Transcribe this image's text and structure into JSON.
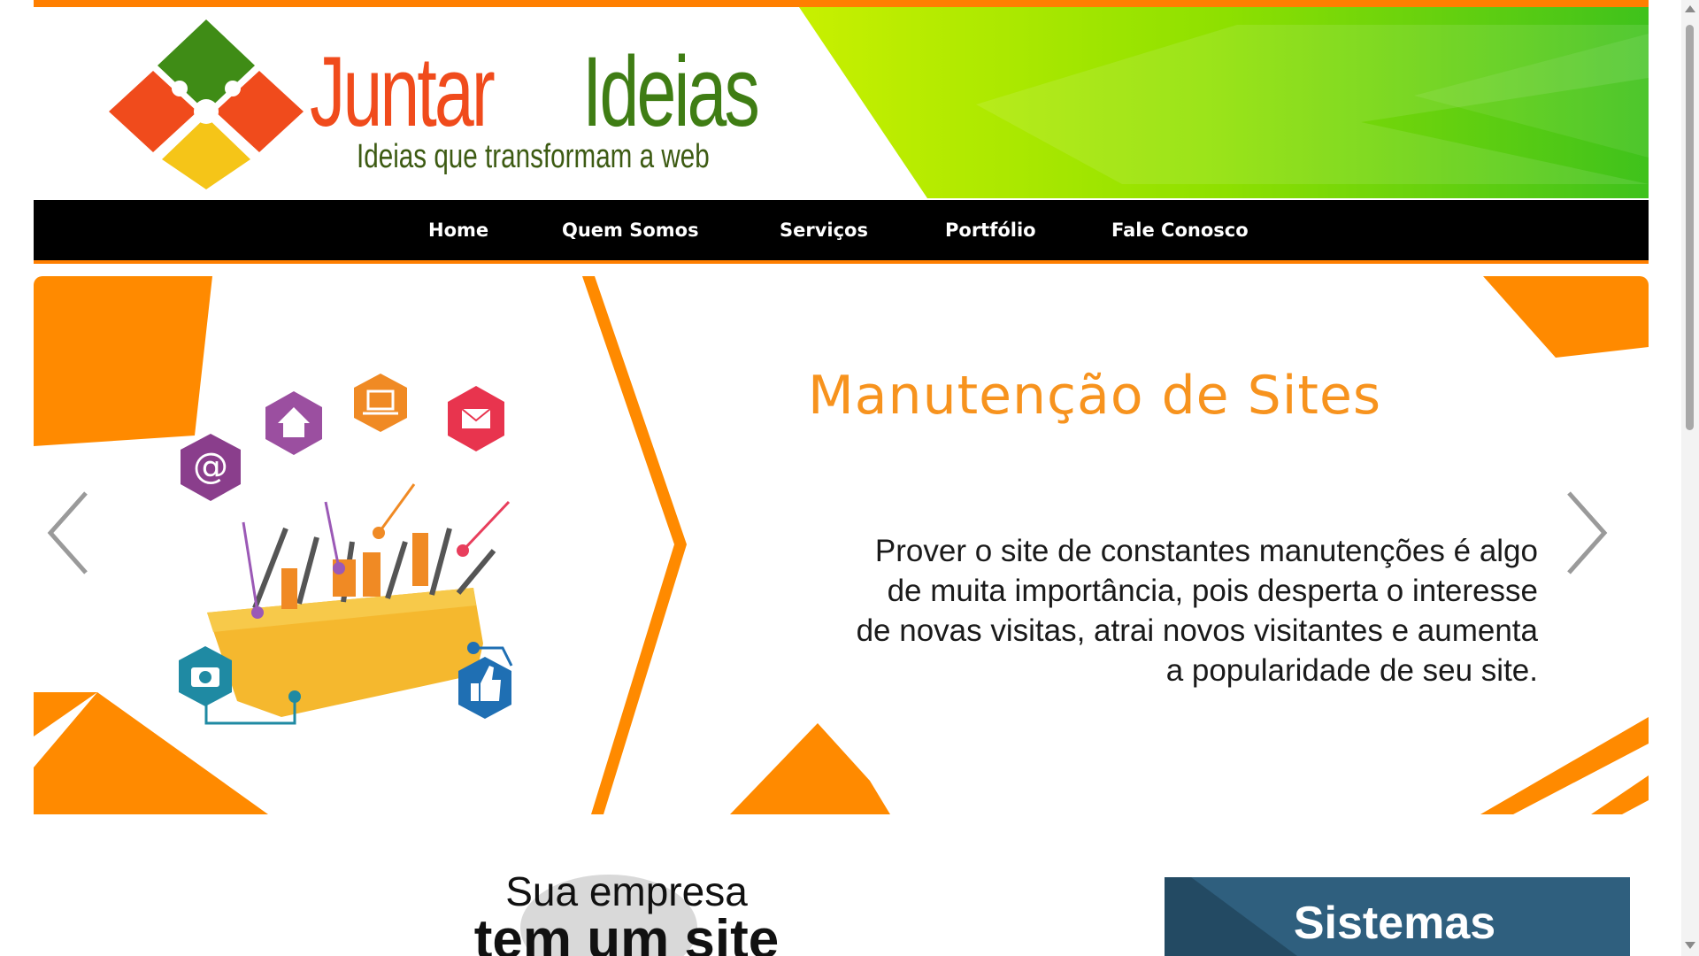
{
  "brand": {
    "name_part1": "Juntar",
    "name_part2": "Ideias",
    "tagline": "Ideias que transformam a web"
  },
  "nav": {
    "items": [
      {
        "label": "Home"
      },
      {
        "label": "Quem Somos"
      },
      {
        "label": "Serviços"
      },
      {
        "label": "Portfólio"
      },
      {
        "label": "Fale Conosco"
      }
    ]
  },
  "slider": {
    "title": "Manutenção de Sites",
    "text_lines": [
      "Prover o site de constantes manutenções é algo",
      "de muita importância, pois desperta o interesse",
      "de novas visitas, atrai novos visitantes e aumenta",
      "a popularidade de  seu  site."
    ],
    "icons": [
      "at-icon",
      "home-icon",
      "laptop-icon",
      "mail-icon",
      "camera-icon",
      "like-icon",
      "toolbox-icon"
    ]
  },
  "promo": {
    "line1": "Sua empresa",
    "line2": "tem um site"
  },
  "systems": {
    "label": "Sistemas"
  },
  "colors": {
    "orange": "#ff7f00",
    "slider_orange": "#f7931e",
    "green": "#7ed321",
    "nav_bg": "#000000",
    "systems_bg": "#2f5f7e"
  }
}
